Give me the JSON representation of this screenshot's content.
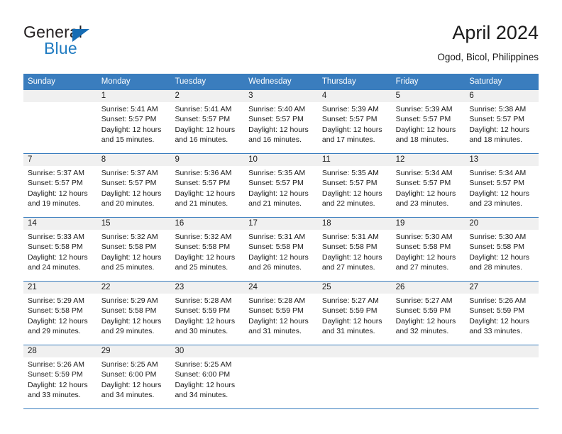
{
  "brand": {
    "name_part1": "General",
    "name_part2": "Blue",
    "triangle_icon": "blue-triangle-icon",
    "color_dark": "#231f20",
    "color_blue": "#1f7bc1"
  },
  "header": {
    "title": "April 2024",
    "subtitle": "Ogod, Bicol, Philippines"
  },
  "theme": {
    "header_blue": "#3a7dbe",
    "daynum_gray": "#f0f0f0",
    "text": "#1a1a1a"
  },
  "weekdays": [
    "Sunday",
    "Monday",
    "Tuesday",
    "Wednesday",
    "Thursday",
    "Friday",
    "Saturday"
  ],
  "weeks": [
    {
      "days": [
        {
          "num": "",
          "lines": [
            "",
            "",
            "",
            ""
          ]
        },
        {
          "num": "1",
          "lines": [
            "Sunrise: 5:41 AM",
            "Sunset: 5:57 PM",
            "Daylight: 12 hours",
            "and 15 minutes."
          ]
        },
        {
          "num": "2",
          "lines": [
            "Sunrise: 5:41 AM",
            "Sunset: 5:57 PM",
            "Daylight: 12 hours",
            "and 16 minutes."
          ]
        },
        {
          "num": "3",
          "lines": [
            "Sunrise: 5:40 AM",
            "Sunset: 5:57 PM",
            "Daylight: 12 hours",
            "and 16 minutes."
          ]
        },
        {
          "num": "4",
          "lines": [
            "Sunrise: 5:39 AM",
            "Sunset: 5:57 PM",
            "Daylight: 12 hours",
            "and 17 minutes."
          ]
        },
        {
          "num": "5",
          "lines": [
            "Sunrise: 5:39 AM",
            "Sunset: 5:57 PM",
            "Daylight: 12 hours",
            "and 18 minutes."
          ]
        },
        {
          "num": "6",
          "lines": [
            "Sunrise: 5:38 AM",
            "Sunset: 5:57 PM",
            "Daylight: 12 hours",
            "and 18 minutes."
          ]
        }
      ]
    },
    {
      "days": [
        {
          "num": "7",
          "lines": [
            "Sunrise: 5:37 AM",
            "Sunset: 5:57 PM",
            "Daylight: 12 hours",
            "and 19 minutes."
          ]
        },
        {
          "num": "8",
          "lines": [
            "Sunrise: 5:37 AM",
            "Sunset: 5:57 PM",
            "Daylight: 12 hours",
            "and 20 minutes."
          ]
        },
        {
          "num": "9",
          "lines": [
            "Sunrise: 5:36 AM",
            "Sunset: 5:57 PM",
            "Daylight: 12 hours",
            "and 21 minutes."
          ]
        },
        {
          "num": "10",
          "lines": [
            "Sunrise: 5:35 AM",
            "Sunset: 5:57 PM",
            "Daylight: 12 hours",
            "and 21 minutes."
          ]
        },
        {
          "num": "11",
          "lines": [
            "Sunrise: 5:35 AM",
            "Sunset: 5:57 PM",
            "Daylight: 12 hours",
            "and 22 minutes."
          ]
        },
        {
          "num": "12",
          "lines": [
            "Sunrise: 5:34 AM",
            "Sunset: 5:57 PM",
            "Daylight: 12 hours",
            "and 23 minutes."
          ]
        },
        {
          "num": "13",
          "lines": [
            "Sunrise: 5:34 AM",
            "Sunset: 5:57 PM",
            "Daylight: 12 hours",
            "and 23 minutes."
          ]
        }
      ]
    },
    {
      "days": [
        {
          "num": "14",
          "lines": [
            "Sunrise: 5:33 AM",
            "Sunset: 5:58 PM",
            "Daylight: 12 hours",
            "and 24 minutes."
          ]
        },
        {
          "num": "15",
          "lines": [
            "Sunrise: 5:32 AM",
            "Sunset: 5:58 PM",
            "Daylight: 12 hours",
            "and 25 minutes."
          ]
        },
        {
          "num": "16",
          "lines": [
            "Sunrise: 5:32 AM",
            "Sunset: 5:58 PM",
            "Daylight: 12 hours",
            "and 25 minutes."
          ]
        },
        {
          "num": "17",
          "lines": [
            "Sunrise: 5:31 AM",
            "Sunset: 5:58 PM",
            "Daylight: 12 hours",
            "and 26 minutes."
          ]
        },
        {
          "num": "18",
          "lines": [
            "Sunrise: 5:31 AM",
            "Sunset: 5:58 PM",
            "Daylight: 12 hours",
            "and 27 minutes."
          ]
        },
        {
          "num": "19",
          "lines": [
            "Sunrise: 5:30 AM",
            "Sunset: 5:58 PM",
            "Daylight: 12 hours",
            "and 27 minutes."
          ]
        },
        {
          "num": "20",
          "lines": [
            "Sunrise: 5:30 AM",
            "Sunset: 5:58 PM",
            "Daylight: 12 hours",
            "and 28 minutes."
          ]
        }
      ]
    },
    {
      "days": [
        {
          "num": "21",
          "lines": [
            "Sunrise: 5:29 AM",
            "Sunset: 5:58 PM",
            "Daylight: 12 hours",
            "and 29 minutes."
          ]
        },
        {
          "num": "22",
          "lines": [
            "Sunrise: 5:29 AM",
            "Sunset: 5:58 PM",
            "Daylight: 12 hours",
            "and 29 minutes."
          ]
        },
        {
          "num": "23",
          "lines": [
            "Sunrise: 5:28 AM",
            "Sunset: 5:59 PM",
            "Daylight: 12 hours",
            "and 30 minutes."
          ]
        },
        {
          "num": "24",
          "lines": [
            "Sunrise: 5:28 AM",
            "Sunset: 5:59 PM",
            "Daylight: 12 hours",
            "and 31 minutes."
          ]
        },
        {
          "num": "25",
          "lines": [
            "Sunrise: 5:27 AM",
            "Sunset: 5:59 PM",
            "Daylight: 12 hours",
            "and 31 minutes."
          ]
        },
        {
          "num": "26",
          "lines": [
            "Sunrise: 5:27 AM",
            "Sunset: 5:59 PM",
            "Daylight: 12 hours",
            "and 32 minutes."
          ]
        },
        {
          "num": "27",
          "lines": [
            "Sunrise: 5:26 AM",
            "Sunset: 5:59 PM",
            "Daylight: 12 hours",
            "and 33 minutes."
          ]
        }
      ]
    },
    {
      "days": [
        {
          "num": "28",
          "lines": [
            "Sunrise: 5:26 AM",
            "Sunset: 5:59 PM",
            "Daylight: 12 hours",
            "and 33 minutes."
          ]
        },
        {
          "num": "29",
          "lines": [
            "Sunrise: 5:25 AM",
            "Sunset: 6:00 PM",
            "Daylight: 12 hours",
            "and 34 minutes."
          ]
        },
        {
          "num": "30",
          "lines": [
            "Sunrise: 5:25 AM",
            "Sunset: 6:00 PM",
            "Daylight: 12 hours",
            "and 34 minutes."
          ]
        },
        {
          "num": "",
          "lines": [
            "",
            "",
            "",
            ""
          ]
        },
        {
          "num": "",
          "lines": [
            "",
            "",
            "",
            ""
          ]
        },
        {
          "num": "",
          "lines": [
            "",
            "",
            "",
            ""
          ]
        },
        {
          "num": "",
          "lines": [
            "",
            "",
            "",
            ""
          ]
        }
      ]
    }
  ]
}
